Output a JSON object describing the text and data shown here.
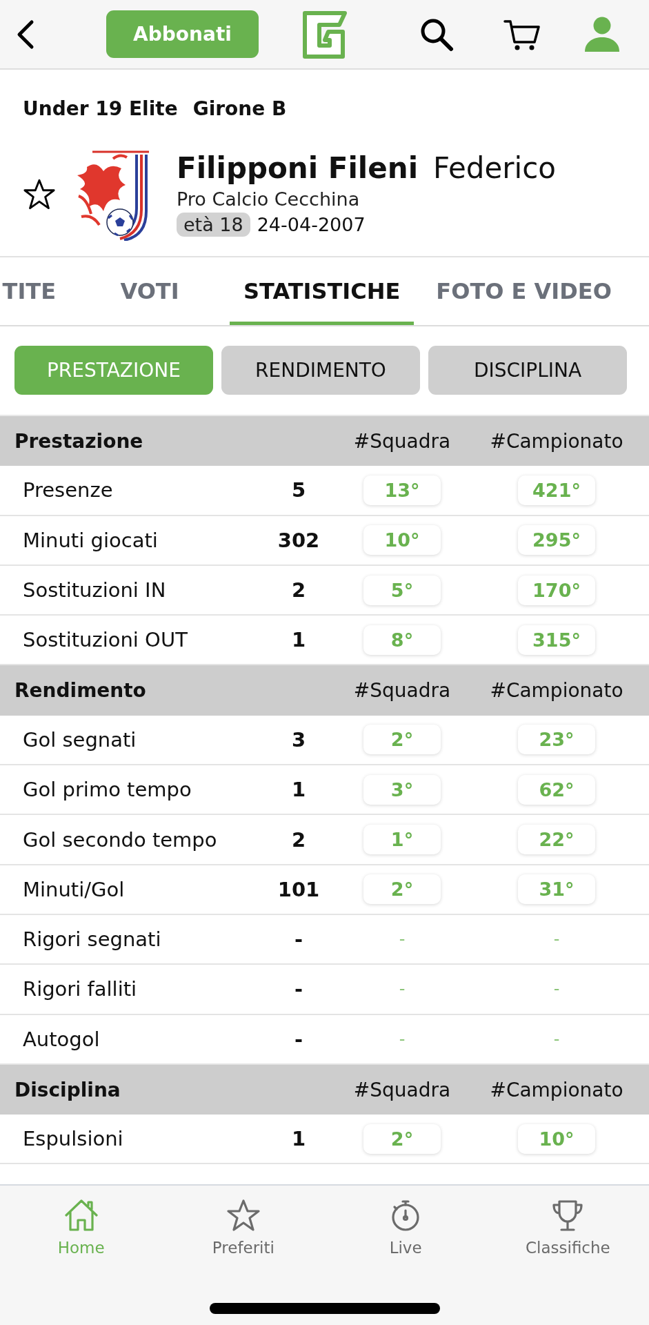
{
  "top_bar": {
    "subscribe_button": "Abbonati"
  },
  "competition": {
    "category": "Under 19 Elite",
    "group": "Girone B"
  },
  "player": {
    "favorite": false,
    "surname": "Filipponi Fileni",
    "first_name": "Federico",
    "team": "Pro Calcio Cecchina",
    "age": "età 18",
    "birth_date": "24-04-2007"
  },
  "tabs": [
    {
      "label": "TITE",
      "selected": false
    },
    {
      "label": "VOTI",
      "selected": false
    },
    {
      "label": "STATISTICHE",
      "selected": true
    },
    {
      "label": "FOTO E VIDEO",
      "selected": false
    }
  ],
  "sub_tabs": [
    {
      "label": "PRESTAZIONE",
      "selected": true
    },
    {
      "label": "RENDIMENTO",
      "selected": false
    },
    {
      "label": "DISCIPLINA",
      "selected": false
    }
  ],
  "sections": [
    {
      "title": "Prestazione",
      "columns": [
        "#Squadra",
        "#Campionato"
      ],
      "rows": [
        {
          "label": "Presenze",
          "value": "5",
          "ranked": true,
          "team_rank": "13°",
          "league_rank": "421°"
        },
        {
          "label": "Minuti giocati",
          "value": "302",
          "ranked": true,
          "team_rank": "10°",
          "league_rank": "295°"
        },
        {
          "label": "Sostituzioni IN",
          "value": "2",
          "ranked": true,
          "team_rank": "5°",
          "league_rank": "170°"
        },
        {
          "label": "Sostituzioni OUT",
          "value": "1",
          "ranked": true,
          "team_rank": "8°",
          "league_rank": "315°"
        }
      ]
    },
    {
      "title": "Rendimento",
      "columns": [
        "#Squadra",
        "#Campionato"
      ],
      "rows": [
        {
          "label": "Gol segnati",
          "value": "3",
          "ranked": true,
          "team_rank": "2°",
          "league_rank": "23°"
        },
        {
          "label": "Gol primo tempo",
          "value": "1",
          "ranked": true,
          "team_rank": "3°",
          "league_rank": "62°"
        },
        {
          "label": "Gol secondo tempo",
          "value": "2",
          "ranked": true,
          "team_rank": "1°",
          "league_rank": "22°"
        },
        {
          "label": "Minuti/Gol",
          "value": "101",
          "ranked": true,
          "team_rank": "2°",
          "league_rank": "31°"
        },
        {
          "label": "Rigori segnati",
          "value": "-",
          "ranked": false,
          "team_rank": "-",
          "league_rank": "-"
        },
        {
          "label": "Rigori falliti",
          "value": "-",
          "ranked": false,
          "team_rank": "-",
          "league_rank": "-"
        },
        {
          "label": "Autogol",
          "value": "-",
          "ranked": false,
          "team_rank": "-",
          "league_rank": "-"
        }
      ]
    },
    {
      "title": "Disciplina",
      "columns": [
        "#Squadra",
        "#Campionato"
      ],
      "rows": [
        {
          "label": "Espulsioni",
          "value": "1",
          "ranked": true,
          "team_rank": "2°",
          "league_rank": "10°"
        }
      ]
    }
  ],
  "bottom_nav": [
    {
      "kind": "home",
      "label": "Home",
      "selected": true
    },
    {
      "kind": "star",
      "label": "Preferiti",
      "selected": false
    },
    {
      "kind": "stopwatch",
      "label": "Live",
      "selected": false
    },
    {
      "kind": "trophy",
      "label": "Classifiche",
      "selected": false
    }
  ]
}
